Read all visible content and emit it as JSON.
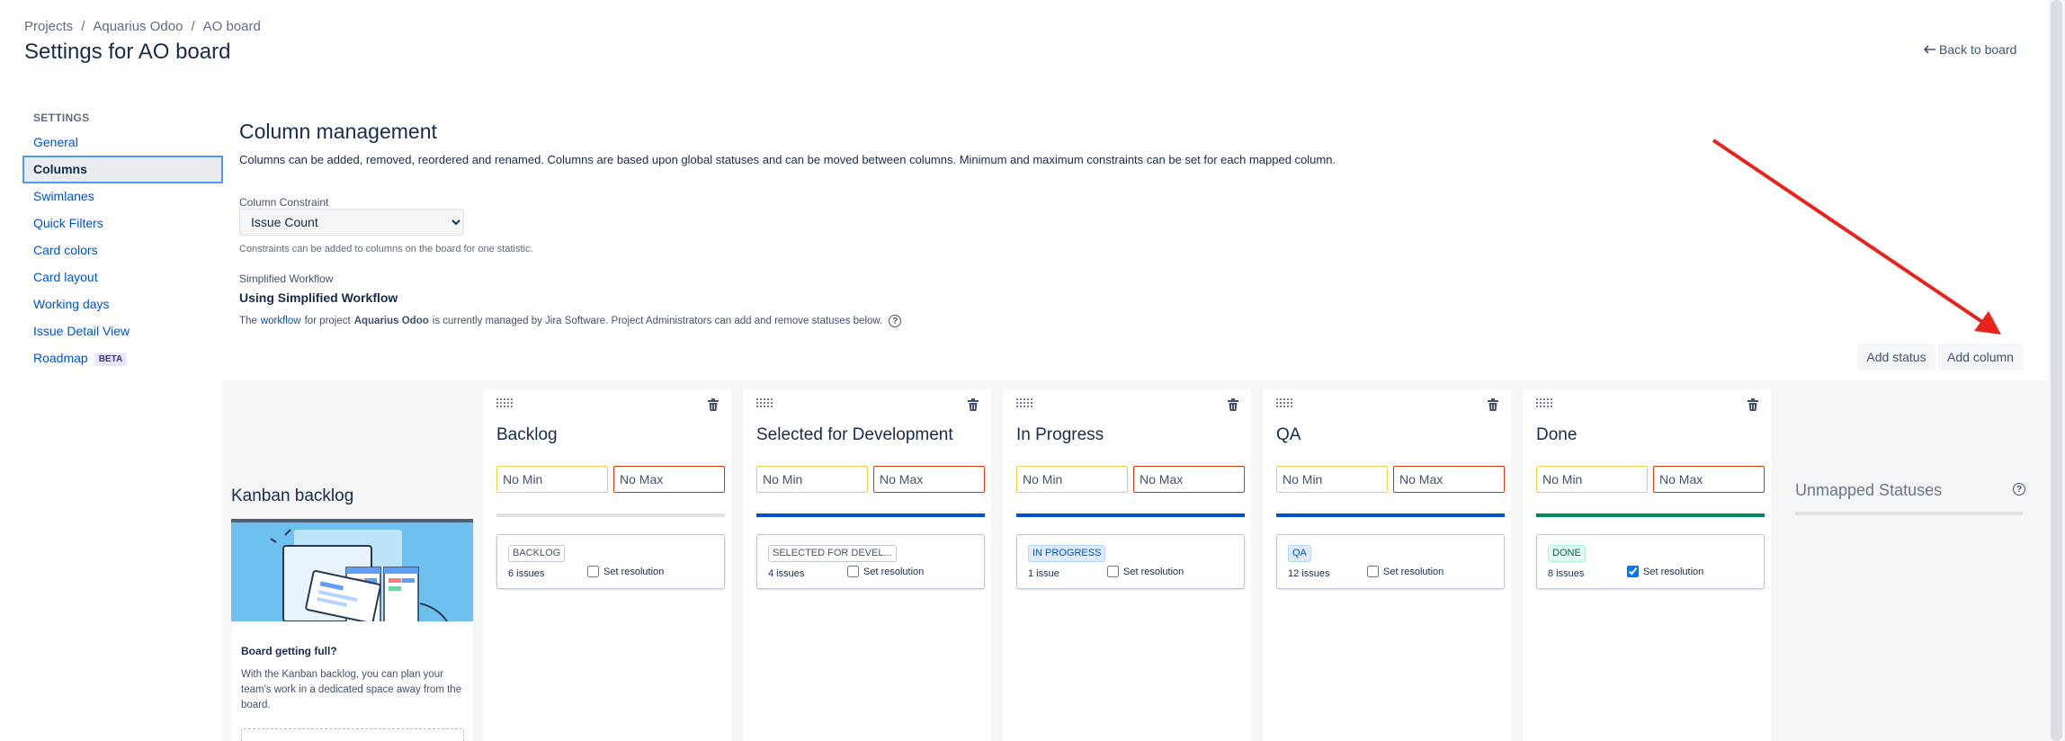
{
  "breadcrumb": [
    {
      "label": "Projects"
    },
    {
      "label": "Aquarius Odoo"
    },
    {
      "label": "AO board"
    }
  ],
  "breadcrumb_separator": "/",
  "page_title": "Settings for AO board",
  "back_link": "Back to board",
  "sidebar": {
    "heading": "SETTINGS",
    "items": [
      {
        "label": "General"
      },
      {
        "label": "Columns"
      },
      {
        "label": "Swimlanes"
      },
      {
        "label": "Quick Filters"
      },
      {
        "label": "Card colors"
      },
      {
        "label": "Card layout"
      },
      {
        "label": "Working days"
      },
      {
        "label": "Issue Detail View"
      },
      {
        "label": "Roadmap",
        "badge": "BETA"
      }
    ],
    "active": "Columns"
  },
  "main": {
    "title": "Column management",
    "description": "Columns can be added, removed, reordered and renamed. Columns are based upon global statuses and can be moved between columns. Minimum and maximum constraints can be set for each mapped column.",
    "constraint_label": "Column Constraint",
    "constraint_value": "Issue Count",
    "constraint_hint": "Constraints can be added to columns on the board for one statistic.",
    "workflow_label": "Simplified Workflow",
    "workflow_title": "Using Simplified Workflow",
    "workflow_desc": {
      "prefix": "The",
      "link": "workflow",
      "middle": "for project",
      "project": "Aquarius Odoo",
      "suffix": "is currently managed by Jira Software. Project Administrators can add and remove statuses below."
    },
    "help_glyph": "?",
    "add_status": "Add status",
    "add_column": "Add column"
  },
  "kanban_backlog": {
    "title": "Kanban backlog",
    "card_title": "Board getting full?",
    "card_text": "With the Kanban backlog, you can plan your team's work in a dedicated space away from the board."
  },
  "columns": [
    {
      "name": "Backlog",
      "min_placeholder": "No Min",
      "max_placeholder": "No Max",
      "bar_color": "#dfe1e6",
      "status": "BACKLOG",
      "lozenge_fg": "#42526e",
      "lozenge_bg": "#ffffff",
      "lozenge_border": "#c1c7d0",
      "count": "6 issues",
      "resolution_label": "Set resolution",
      "resolution_checked": false
    },
    {
      "name": "Selected for Development",
      "min_placeholder": "No Min",
      "max_placeholder": "No Max",
      "bar_color": "#0052cc",
      "status": "SELECTED FOR DEVEL...",
      "lozenge_fg": "#42526e",
      "lozenge_bg": "#ffffff",
      "lozenge_border": "#c1c7d0",
      "count": "4 issues",
      "resolution_label": "Set resolution",
      "resolution_checked": false
    },
    {
      "name": "In Progress",
      "min_placeholder": "No Min",
      "max_placeholder": "No Max",
      "bar_color": "#0052cc",
      "status": "IN PROGRESS",
      "lozenge_fg": "#0052cc",
      "lozenge_bg": "#deebff",
      "lozenge_border": "#b3d4ff",
      "count": "1 issue",
      "resolution_label": "Set resolution",
      "resolution_checked": false
    },
    {
      "name": "QA",
      "min_placeholder": "No Min",
      "max_placeholder": "No Max",
      "bar_color": "#0052cc",
      "status": "QA",
      "lozenge_fg": "#0052cc",
      "lozenge_bg": "#deebff",
      "lozenge_border": "#b3d4ff",
      "count": "12 issues",
      "resolution_label": "Set resolution",
      "resolution_checked": false
    },
    {
      "name": "Done",
      "min_placeholder": "No Min",
      "max_placeholder": "No Max",
      "bar_color": "#00875a",
      "status": "DONE",
      "lozenge_fg": "#006644",
      "lozenge_bg": "#e3fcef",
      "lozenge_border": "#abf5d1",
      "count": "8 issues",
      "resolution_label": "Set resolution",
      "resolution_checked": true
    }
  ],
  "unmapped": {
    "title": "Unmapped Statuses"
  },
  "annotation": {
    "color": "#e8231c",
    "icon": "red-arrow-icon"
  }
}
